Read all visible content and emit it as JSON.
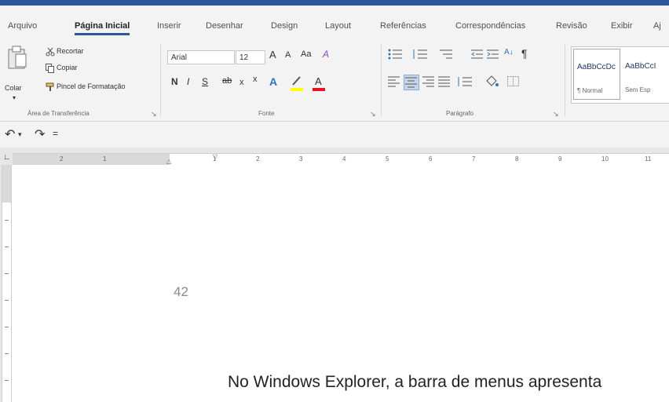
{
  "tabs": [
    {
      "label": "Arquivo",
      "active": false
    },
    {
      "label": "Página Inicial",
      "active": true
    },
    {
      "label": "Inserir",
      "active": false
    },
    {
      "label": "Desenhar",
      "active": false
    },
    {
      "label": "Design",
      "active": false
    },
    {
      "label": "Layout",
      "active": false
    },
    {
      "label": "Referências",
      "active": false
    },
    {
      "label": "Correspondências",
      "active": false
    },
    {
      "label": "Revisão",
      "active": false
    },
    {
      "label": "Exibir",
      "active": false
    },
    {
      "label": "Aj",
      "active": false
    }
  ],
  "clipboard": {
    "paste_label": "Colar",
    "cut_label": "Recortar",
    "copy_label": "Copiar",
    "format_painter_label": "Pincel de Formatação",
    "group_label": "Área de Transferência"
  },
  "font": {
    "font_name": "Arial",
    "font_size": "12",
    "grow": "A",
    "shrink": "A",
    "change_case": "Aa",
    "clear": "A",
    "bold": "N",
    "italic": "I",
    "underline": "S",
    "strike": "ab",
    "subscript": "x",
    "superscript": "x",
    "text_effects": "A",
    "highlight": "ab",
    "font_color": "A",
    "group_label": "Fonte"
  },
  "paragraph": {
    "pilcrow": "¶",
    "sort": "A↓",
    "group_label": "Parágrafo"
  },
  "styles": [
    {
      "preview": "AaBbCcDc",
      "name": "¶ Normal"
    },
    {
      "preview": "AaBbCcI",
      "name": "Sem Esp"
    }
  ],
  "qat": {
    "undo": "↶",
    "redo": "↷",
    "customize": "="
  },
  "ruler": {
    "numbers": [
      "2",
      "1",
      "1",
      "2",
      "3",
      "4",
      "5",
      "6",
      "7",
      "8",
      "9",
      "10",
      "11"
    ]
  },
  "document": {
    "page_number": "42",
    "body_text": "No Windows Explorer, a barra de menus apresenta"
  },
  "colors": {
    "accent": "#2b579a",
    "highlight_yellow": "#ffff00",
    "font_red": "#e81123"
  }
}
